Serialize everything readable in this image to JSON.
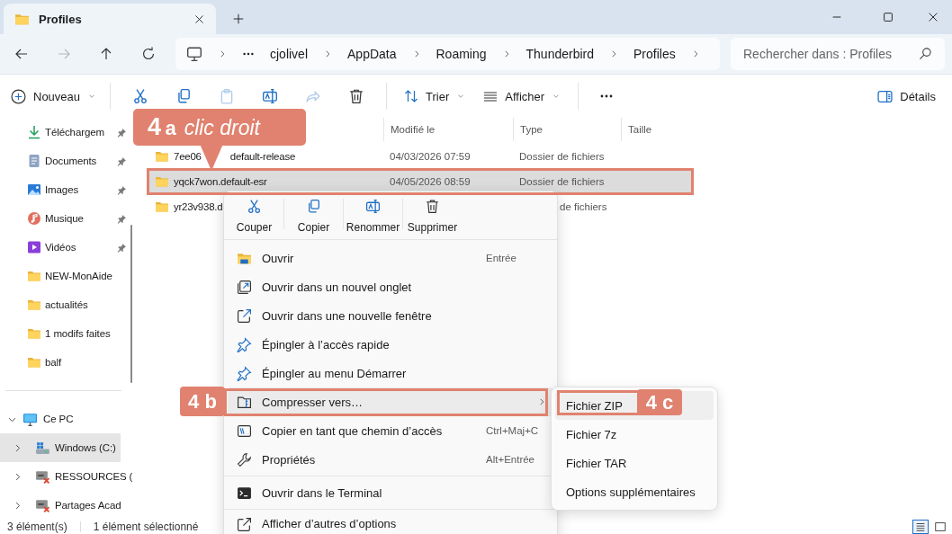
{
  "window": {
    "tab_title": "Profiles"
  },
  "navigation": [
    {
      "kind": "back",
      "disabled": false
    },
    {
      "kind": "forward",
      "disabled": true
    },
    {
      "kind": "up",
      "disabled": false
    },
    {
      "kind": "refresh",
      "disabled": false
    }
  ],
  "breadcrumb": [
    "cjolivel",
    "AppData",
    "Roaming",
    "Thunderbird",
    "Profiles"
  ],
  "search": {
    "placeholder": "Rechercher dans : Profiles"
  },
  "toolbar": {
    "new": "Nouveau",
    "actions": [
      {
        "kind": "cut",
        "disabled": false
      },
      {
        "kind": "copy",
        "disabled": false
      },
      {
        "kind": "paste",
        "disabled": true
      },
      {
        "kind": "rename",
        "disabled": false
      },
      {
        "kind": "share",
        "disabled": true
      },
      {
        "kind": "delete",
        "disabled": false
      }
    ],
    "sort": "Trier",
    "view": "Afficher",
    "details": "Détails"
  },
  "sidebar": {
    "quick_access": [
      {
        "label": "Téléchargem",
        "kind": "downloads",
        "pinned": true
      },
      {
        "label": "Documents",
        "kind": "documents",
        "pinned": true
      },
      {
        "label": "Images",
        "kind": "images",
        "pinned": true
      },
      {
        "label": "Musique",
        "kind": "music",
        "pinned": true
      },
      {
        "label": "Vidéos",
        "kind": "videos",
        "pinned": true
      },
      {
        "label": "NEW-MonAide",
        "kind": "folder",
        "pinned": false
      },
      {
        "label": "actualités",
        "kind": "folder",
        "pinned": false
      },
      {
        "label": "1 modifs faites",
        "kind": "folder",
        "pinned": false
      },
      {
        "label": "balf",
        "kind": "folder",
        "pinned": false
      }
    ],
    "this_pc": {
      "label": "Ce PC",
      "expanded": true,
      "children": [
        {
          "label": "Windows (C:)",
          "kind": "drive",
          "expanded": false,
          "selected": true
        },
        {
          "label": "RESSOURCES (",
          "kind": "network-drive",
          "expanded": false,
          "selected": false
        },
        {
          "label": "Partages Acad",
          "kind": "network-drive",
          "expanded": false,
          "selected": false
        }
      ]
    }
  },
  "file_list": {
    "columns": [
      "Modifié le",
      "Type",
      "Taille"
    ],
    "rows": [
      {
        "name_parts": [
          "7ee06",
          "default-release"
        ],
        "modified": "04/03/2026 07:59",
        "type": "Dossier de fichiers",
        "selected": false
      },
      {
        "name_parts": [
          "yqck7won.default-esr"
        ],
        "modified": "04/05/2026 08:59",
        "type": "Dossier de fichiers",
        "selected": true
      },
      {
        "name_parts": [
          "yr23v938.d"
        ],
        "type": "de fichiers",
        "selected": false
      }
    ]
  },
  "context_menu": {
    "quick_actions": [
      {
        "kind": "cut",
        "label": "Couper"
      },
      {
        "kind": "copy",
        "label": "Copier"
      },
      {
        "kind": "rename",
        "label": "Renommer"
      },
      {
        "kind": "delete",
        "label": "Supprimer"
      }
    ],
    "items": [
      {
        "kind": "open",
        "label": "Ouvrir",
        "shortcut": "Entrée",
        "selected": false,
        "submenu": false
      },
      {
        "kind": "new-tab",
        "label": "Ouvrir dans un nouvel onglet",
        "selected": false,
        "submenu": false
      },
      {
        "kind": "new-window",
        "label": "Ouvrir dans une nouvelle fenêtre",
        "selected": false,
        "submenu": false
      },
      {
        "kind": "pin",
        "label": "Épingler à l’accès rapide",
        "selected": false,
        "submenu": false
      },
      {
        "kind": "pin",
        "label": "Épingler au menu Démarrer",
        "selected": false,
        "submenu": false
      },
      {
        "kind": "compress",
        "label": "Compresser vers…",
        "selected": true,
        "submenu": true
      },
      {
        "kind": "copy-path",
        "label": "Copier en tant que chemin d’accès",
        "shortcut": "Ctrl+Maj+C",
        "selected": false,
        "submenu": false
      },
      {
        "kind": "properties",
        "label": "Propriétés",
        "shortcut": "Alt+Entrée",
        "selected": false,
        "submenu": false
      },
      {
        "kind": "separator"
      },
      {
        "kind": "terminal",
        "label": "Ouvrir dans le Terminal",
        "selected": false,
        "submenu": false
      },
      {
        "kind": "separator"
      },
      {
        "kind": "more-options",
        "label": "Afficher d’autres d’options",
        "selected": false,
        "submenu": false
      }
    ]
  },
  "submenu": {
    "items": [
      {
        "label": "Fichier ZIP",
        "selected": true
      },
      {
        "label": "Fichier 7z",
        "selected": false
      },
      {
        "label": "Fichier TAR",
        "selected": false
      },
      {
        "label": "Options supplémentaires",
        "selected": false
      }
    ]
  },
  "annotations": [
    {
      "number": "4",
      "letter": "a",
      "text": "clic droit"
    },
    {
      "number": "4",
      "letter": "b"
    },
    {
      "number": "4",
      "letter": "c"
    }
  ],
  "status_bar": {
    "count": "3 élément(s)",
    "selection": "1 élément sélectionné",
    "views": [
      {
        "kind": "details",
        "selected": true
      },
      {
        "kind": "tiles",
        "selected": false
      }
    ]
  }
}
